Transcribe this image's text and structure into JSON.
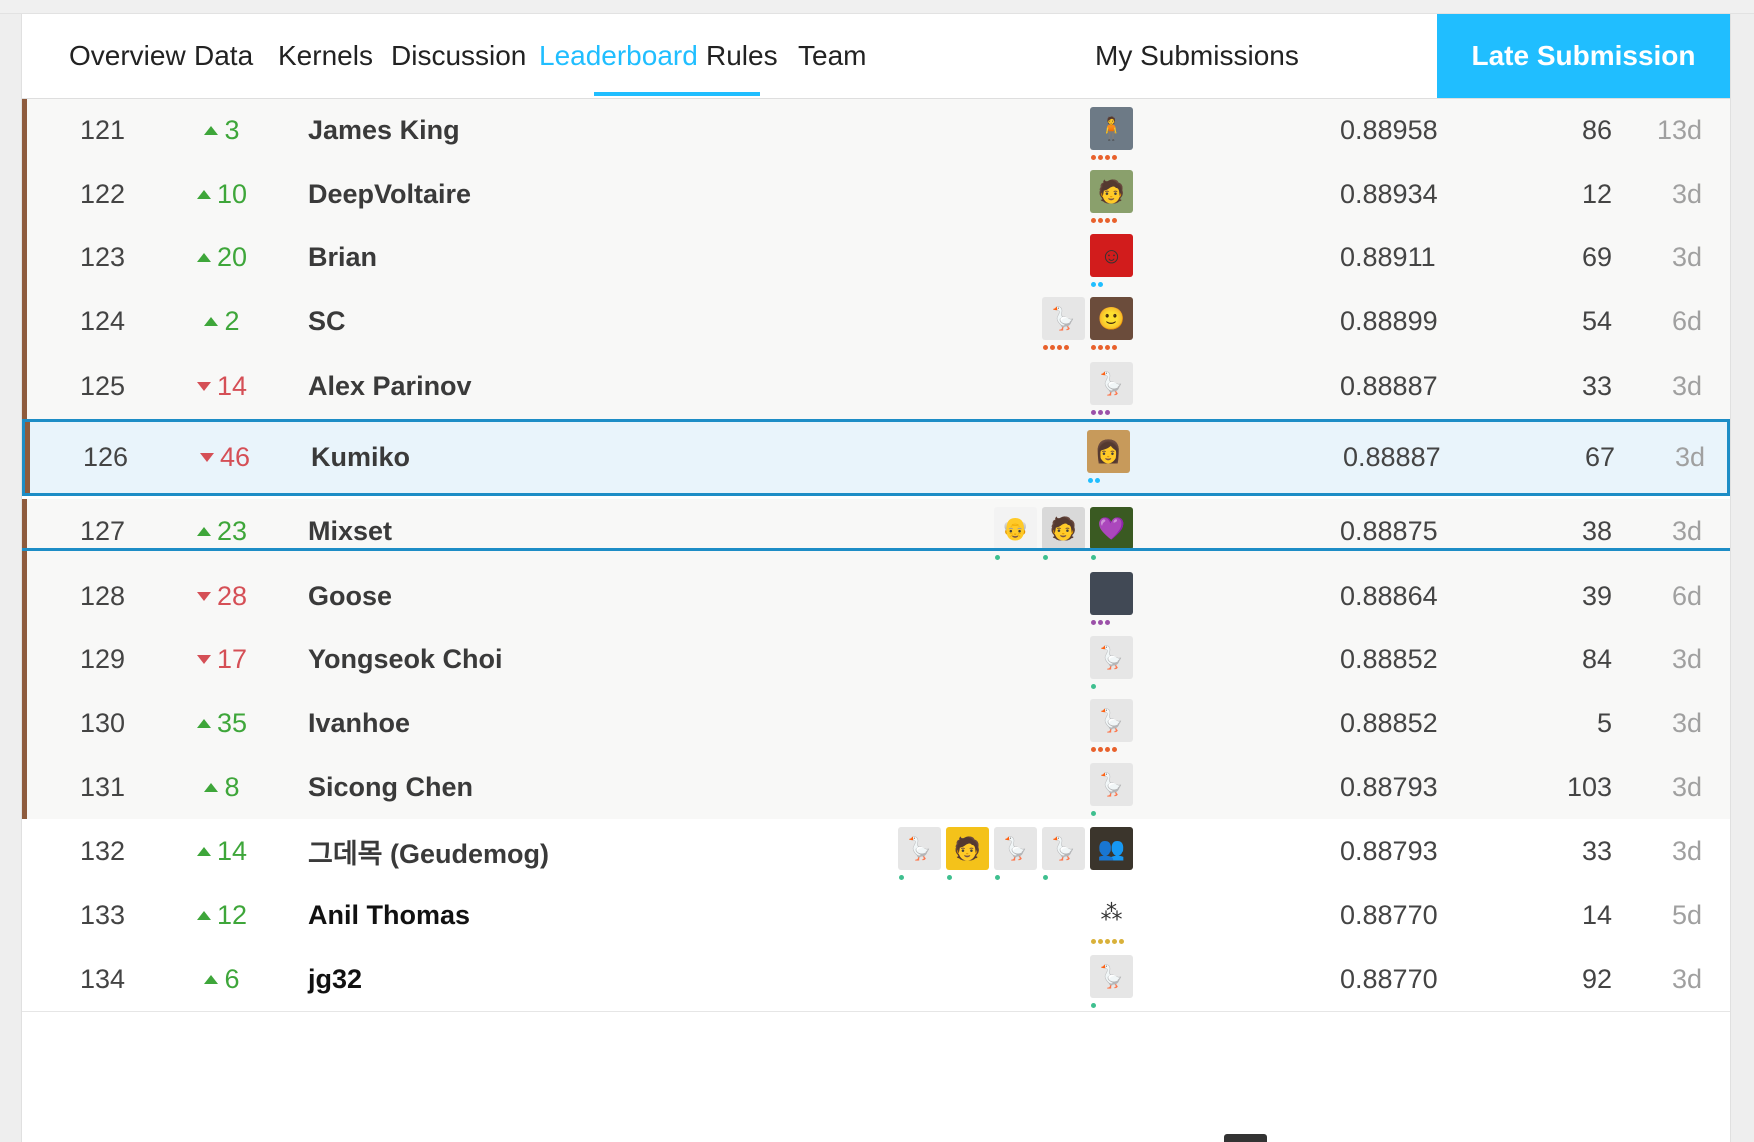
{
  "nav": {
    "tabs": [
      {
        "label": "Overview"
      },
      {
        "label": "Data"
      },
      {
        "label": "Kernels"
      },
      {
        "label": "Discussion"
      },
      {
        "label": "Leaderboard",
        "active": true
      },
      {
        "label": "Rules"
      },
      {
        "label": "Team"
      }
    ],
    "my_submissions": "My Submissions",
    "late_submission": "Late Submission"
  },
  "colors": {
    "accent": "#20beff",
    "highlight_border": "#1d8dc6",
    "medal_bronze": "#8e5b3d",
    "up": "#3ea63a",
    "down": "#d54f56"
  },
  "rows": [
    {
      "rank": "121",
      "dir": "up",
      "delta": "3",
      "name": "James King",
      "score": "0.88958",
      "entries": "86",
      "last": "13d",
      "avatars": [
        {
          "icon": "photo-icon",
          "bg": "#6d7a86",
          "glyph": "🧍",
          "dots": [
            "#e8612c",
            "#e8612c",
            "#e8612c",
            "#e8612c"
          ]
        }
      ],
      "medal": true
    },
    {
      "rank": "122",
      "dir": "up",
      "delta": "10",
      "name": "DeepVoltaire",
      "score": "0.88934",
      "entries": "12",
      "last": "3d",
      "avatars": [
        {
          "icon": "photo-icon",
          "bg": "#8aa06c",
          "glyph": "🧑",
          "dots": [
            "#e8612c",
            "#e8612c",
            "#e8612c",
            "#e8612c"
          ]
        }
      ],
      "medal": true
    },
    {
      "rank": "123",
      "dir": "up",
      "delta": "20",
      "name": "Brian",
      "score": "0.88911",
      "entries": "69",
      "last": "3d",
      "avatars": [
        {
          "icon": "photo-icon",
          "bg": "#d21c1c",
          "glyph": "☺",
          "dots": [
            "#20beff",
            "#20beff"
          ]
        }
      ],
      "medal": true
    },
    {
      "rank": "124",
      "dir": "up",
      "delta": "2",
      "name": "SC",
      "score": "0.88899",
      "entries": "54",
      "last": "6d",
      "avatars": [
        {
          "icon": "goose-icon",
          "bg": "#e6e6e6",
          "glyph": "🪿",
          "dots": [
            "#e8612c",
            "#e8612c",
            "#e8612c",
            "#e8612c"
          ]
        },
        {
          "icon": "photo-icon",
          "bg": "#6b4c3b",
          "glyph": "🙂",
          "dots": [
            "#e8612c",
            "#e8612c",
            "#e8612c",
            "#e8612c"
          ]
        }
      ],
      "medal": true
    },
    {
      "rank": "125",
      "dir": "down",
      "delta": "14",
      "name": "Alex Parinov",
      "score": "0.88887",
      "entries": "33",
      "last": "3d",
      "avatars": [
        {
          "icon": "goose-icon",
          "bg": "#e6e6e6",
          "glyph": "🪿",
          "dots": [
            "#9b51a8",
            "#9b51a8",
            "#9b51a8"
          ]
        }
      ],
      "medal": true
    },
    {
      "rank": "126",
      "dir": "down",
      "delta": "46",
      "name": "Kumiko",
      "score": "0.88887",
      "entries": "67",
      "last": "3d",
      "avatars": [
        {
          "icon": "photo-icon",
          "bg": "#c79a5b",
          "glyph": "👩",
          "dots": [
            "#20beff",
            "#20beff"
          ]
        }
      ],
      "me": true
    },
    {
      "rank": "127",
      "dir": "up",
      "delta": "23",
      "name": "Mixset",
      "score": "0.88875",
      "entries": "38",
      "last": "3d",
      "avatars": [
        {
          "icon": "cartoon-icon",
          "bg": "#f3f3f3",
          "glyph": "👴",
          "dots": [
            "#3fbf8f"
          ]
        },
        {
          "icon": "photo-icon",
          "bg": "#d9d9d9",
          "glyph": "🧑",
          "dots": [
            "#3fbf8f"
          ]
        },
        {
          "icon": "heart-icon",
          "bg": "#3a5a22",
          "glyph": "💜",
          "dots": [
            "#3fbf8f"
          ]
        }
      ],
      "medal": true
    },
    {
      "rank": "128",
      "dir": "down",
      "delta": "28",
      "name": "Goose",
      "score": "0.88864",
      "entries": "39",
      "last": "6d",
      "avatars": [
        {
          "icon": "photo-icon",
          "bg": "#414955",
          "glyph": "",
          "dots": [
            "#9b51a8",
            "#9b51a8",
            "#9b51a8"
          ]
        }
      ],
      "medal": true
    },
    {
      "rank": "129",
      "dir": "down",
      "delta": "17",
      "name": "Yongseok Choi",
      "score": "0.88852",
      "entries": "84",
      "last": "3d",
      "avatars": [
        {
          "icon": "goose-icon",
          "bg": "#e6e6e6",
          "glyph": "🪿",
          "dots": [
            "#3fbf8f"
          ]
        }
      ],
      "medal": true
    },
    {
      "rank": "130",
      "dir": "up",
      "delta": "35",
      "name": "Ivanhoe",
      "score": "0.88852",
      "entries": "5",
      "last": "3d",
      "avatars": [
        {
          "icon": "goose-icon",
          "bg": "#e6e6e6",
          "glyph": "🪿",
          "dots": [
            "#e8612c",
            "#e8612c",
            "#e8612c",
            "#e8612c"
          ]
        }
      ],
      "medal": true
    },
    {
      "rank": "131",
      "dir": "up",
      "delta": "8",
      "name": "Sicong Chen",
      "score": "0.88793",
      "entries": "103",
      "last": "3d",
      "avatars": [
        {
          "icon": "goose-icon",
          "bg": "#e6e6e6",
          "glyph": "🪿",
          "dots": [
            "#3fbf8f"
          ]
        }
      ],
      "medal": true
    },
    {
      "rank": "132",
      "dir": "up",
      "delta": "14",
      "name": "그데목 (Geudemog)",
      "score": "0.88793",
      "entries": "33",
      "last": "3d",
      "avatars": [
        {
          "icon": "goose-icon",
          "bg": "#e6e6e6",
          "glyph": "🪿",
          "dots": [
            "#3fbf8f"
          ]
        },
        {
          "icon": "cartoon-icon",
          "bg": "#f4c21a",
          "glyph": "🧑",
          "dots": [
            "#3fbf8f"
          ]
        },
        {
          "icon": "goose-icon",
          "bg": "#e6e6e6",
          "glyph": "🪿",
          "dots": [
            "#3fbf8f"
          ]
        },
        {
          "icon": "goose-icon",
          "bg": "#e6e6e6",
          "glyph": "🪿",
          "dots": [
            "#3fbf8f"
          ]
        },
        {
          "icon": "photo-icon",
          "bg": "#3b352c",
          "glyph": "👥",
          "dots": []
        }
      ]
    },
    {
      "rank": "133",
      "dir": "up",
      "delta": "12",
      "name": "Anil Thomas",
      "score": "0.88770",
      "entries": "14",
      "last": "5d",
      "avatars": [
        {
          "icon": "identicon-icon",
          "bg": "#ffffff",
          "glyph": "⁂",
          "dots": [
            "#d9b13a",
            "#d9b13a",
            "#d9b13a",
            "#d9b13a",
            "#d9b13a"
          ]
        }
      ],
      "dark": true
    },
    {
      "rank": "134",
      "dir": "up",
      "delta": "6",
      "name": "jg32",
      "score": "0.88770",
      "entries": "92",
      "last": "3d",
      "avatars": [
        {
          "icon": "goose-icon",
          "bg": "#e6e6e6",
          "glyph": "🪿",
          "dots": [
            "#3fbf8f"
          ]
        }
      ],
      "dark": true
    }
  ]
}
